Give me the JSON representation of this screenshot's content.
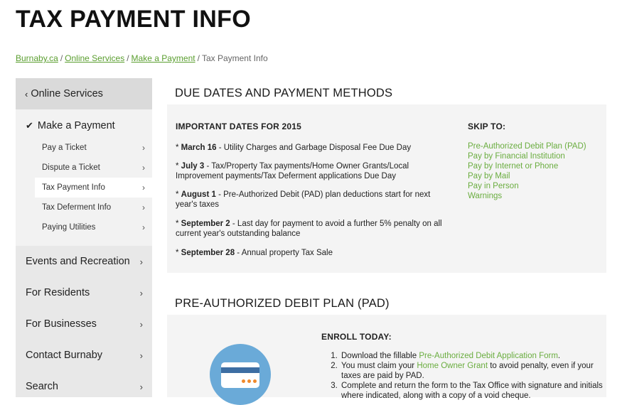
{
  "page": {
    "title": "TAX PAYMENT INFO"
  },
  "breadcrumb": {
    "links": [
      "Burnaby.ca",
      "Online Services",
      "Make a Payment"
    ],
    "current": "Tax Payment Info",
    "separator": "/"
  },
  "sidebar": {
    "back_label": "Online Services",
    "current_label": "Make a Payment",
    "sub_items": [
      {
        "label": "Pay a Ticket"
      },
      {
        "label": "Dispute a Ticket"
      },
      {
        "label": "Tax Payment Info",
        "active": true
      },
      {
        "label": "Tax Deferment Info"
      },
      {
        "label": "Paying Utilities"
      }
    ],
    "items": [
      {
        "label": "Events and Recreation"
      },
      {
        "label": "For Residents"
      },
      {
        "label": "For Businesses"
      },
      {
        "label": "Contact Burnaby"
      },
      {
        "label": "Search"
      }
    ],
    "icons": {
      "back": "chevron-left-icon",
      "current": "checkmark-icon",
      "arrow": "chevron-right-icon"
    }
  },
  "section1": {
    "heading": "DUE DATES AND PAYMENT METHODS",
    "dates_heading": "IMPORTANT DATES FOR 2015",
    "dates": [
      {
        "date": "March 16",
        "text": " - Utility Charges and Garbage Disposal Fee Due Day"
      },
      {
        "date": "July 3",
        "text": " - Tax/Property Tax payments/Home Owner Grants/Local Improvement payments/Tax Deferment applications Due Day"
      },
      {
        "date": "August 1",
        "text": " - Pre-Authorized Debit (PAD) plan deductions start for next year's taxes"
      },
      {
        "date": "September 2",
        "text": " - Last day for payment to avoid a further 5% penalty on all current year's outstanding balance"
      },
      {
        "date": "September 28",
        "text": " - Annual property Tax Sale"
      }
    ],
    "skip_heading": "SKIP TO:",
    "skip_links": [
      "Pre-Authorized Debit Plan (PAD)",
      "Pay by Financial Institution",
      "Pay by Internet or Phone",
      "Pay by Mail",
      "Pay in Person",
      "Warnings"
    ]
  },
  "section2": {
    "heading": "PRE-AUTHORIZED DEBIT PLAN (PAD)",
    "enroll_heading": "ENROLL TODAY:",
    "steps": [
      {
        "pre": "Download the fillable ",
        "link": "Pre-Authorized Debit Application Form",
        "post": "."
      },
      {
        "pre": "You must claim your ",
        "link": "Home Owner Grant",
        "post": " to avoid penalty, even if your taxes are paid by PAD."
      },
      {
        "pre": "Complete and return the form to the Tax Office with signature and initials where indicated, along with a copy of a void cheque.",
        "link": "",
        "post": ""
      }
    ],
    "icon": "credit-card-icon"
  },
  "colors": {
    "link": "#5a9e2f",
    "sidebar_bg": "#e8e8e8",
    "box_bg": "#f4f4f4",
    "circle": "#6aaad8"
  }
}
